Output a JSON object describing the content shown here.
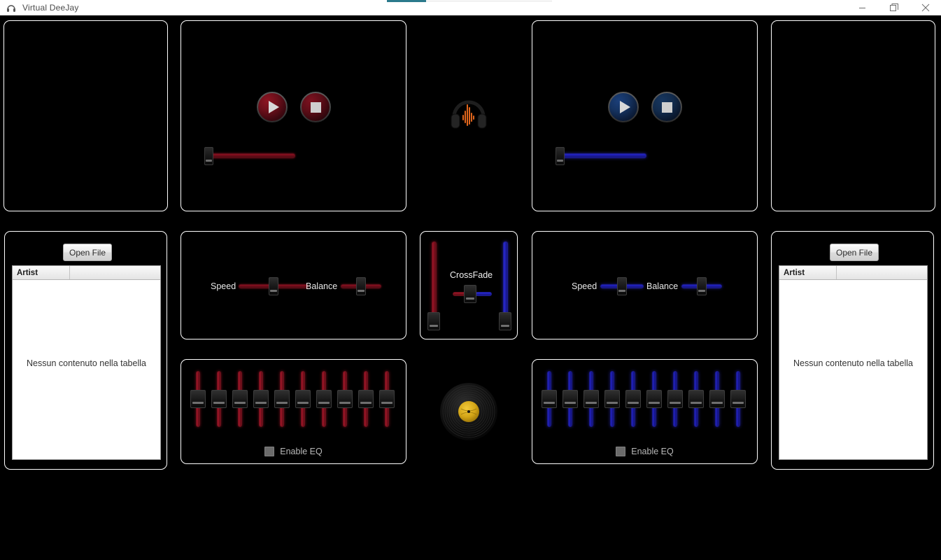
{
  "window": {
    "title": "Virtual DeeJay",
    "app_icon": "headphones-icon",
    "minimize_label": "Minimize",
    "maximize_label": "Restore",
    "close_label": "Close",
    "accent_color": "#2b7a8c"
  },
  "theme": {
    "deck_a_color": "#8a1020",
    "deck_b_color": "#2323c8",
    "panel_border": "#ffffff",
    "background": "#000000"
  },
  "decks": [
    {
      "id": "deck-a",
      "side": "left",
      "color": "red",
      "waveform_panel": {
        "name": "waveform-display-a",
        "content": ""
      },
      "transport": {
        "play_label": "Play",
        "stop_label": "Stop",
        "progress": {
          "value": 0,
          "min": 0,
          "max": 100
        }
      },
      "controls": {
        "speed_label": "Speed",
        "speed_value": 50,
        "balance_label": "Balance",
        "balance_value": 50
      },
      "equalizer": {
        "enable_label": "Enable EQ",
        "enabled": false,
        "band_count": 10,
        "bands": [
          50,
          50,
          50,
          50,
          50,
          50,
          50,
          50,
          50,
          50
        ]
      },
      "library": {
        "open_file_label": "Open File",
        "columns": [
          "Artist",
          ""
        ],
        "rows": [],
        "empty_text": "Nessun contenuto nella tabella"
      }
    },
    {
      "id": "deck-b",
      "side": "right",
      "color": "blue",
      "waveform_panel": {
        "name": "waveform-display-b",
        "content": ""
      },
      "transport": {
        "play_label": "Play",
        "stop_label": "Stop",
        "progress": {
          "value": 0,
          "min": 0,
          "max": 100
        }
      },
      "controls": {
        "speed_label": "Speed",
        "speed_value": 50,
        "balance_label": "Balance",
        "balance_value": 50
      },
      "equalizer": {
        "enable_label": "Enable EQ",
        "enabled": false,
        "band_count": 10,
        "bands": [
          50,
          50,
          50,
          50,
          50,
          50,
          50,
          50,
          50,
          50
        ]
      },
      "library": {
        "open_file_label": "Open File",
        "columns": [
          "Artist",
          ""
        ],
        "rows": [],
        "empty_text": "Nessun contenuto nella tabella"
      }
    }
  ],
  "center": {
    "headphones_icon": "headphones-waveform-icon",
    "vinyl_icon": "vinyl-record-icon",
    "crossfade": {
      "label": "CrossFade",
      "value": 50,
      "volume_a": {
        "value": 0,
        "name": "deck-a-volume-fader"
      },
      "volume_b": {
        "value": 0,
        "name": "deck-b-volume-fader"
      }
    }
  }
}
